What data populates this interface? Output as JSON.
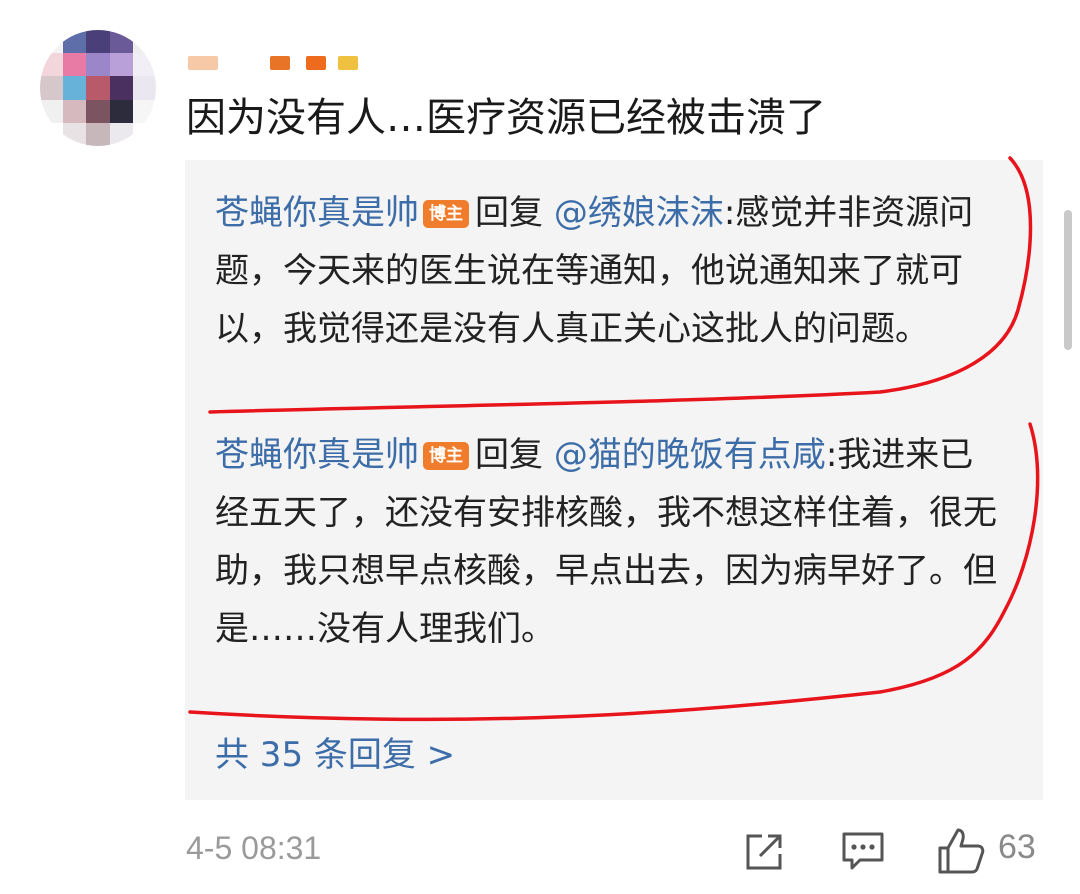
{
  "comment": {
    "text": "因为没有人…医疗资源已经被击溃了",
    "timestamp": "4-5 08:31",
    "like_count": "63"
  },
  "replies": [
    {
      "author": "苍蝇你真是帅",
      "badge": "博主",
      "reply_word": "回复",
      "mention": "@绣娘沫沫",
      "text": ":感觉并非资源问题，今天来的医生说在等通知，他说通知来了就可以，我觉得还是没有人真正关心这批人的问题。"
    },
    {
      "author": "苍蝇你真是帅",
      "badge": "博主",
      "reply_word": "回复",
      "mention": "@猫的晚饭有点咸",
      "text": ":我进来已经五天了，还没有安排核酸，我不想这样住着，很无助，我只想早点核酸，早点出去，因为病早好了。但是……没有人理我们。"
    }
  ],
  "more_replies": "共 35 条回复 >",
  "icons": {
    "share": "share-icon",
    "comment": "comment-icon",
    "like": "thumbs-up-icon"
  },
  "colors": {
    "link": "#3d6da8",
    "badge": "#f07d2c",
    "annotation": "#e8141c"
  }
}
